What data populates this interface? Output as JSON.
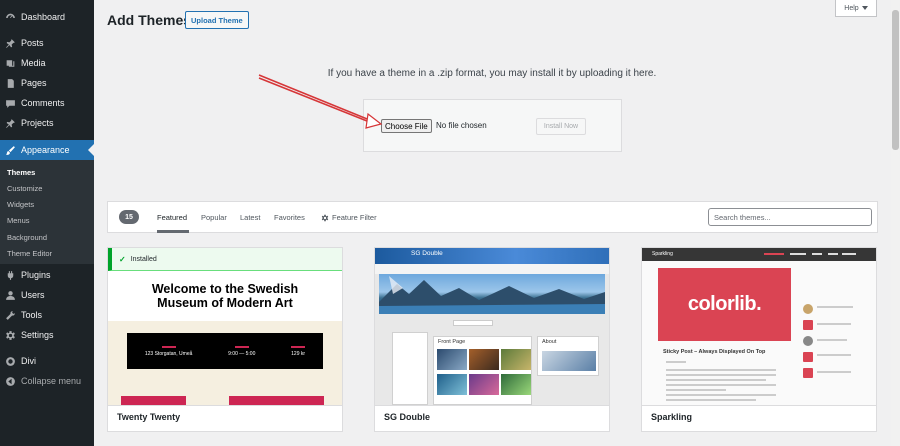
{
  "sidebar": {
    "items": [
      {
        "label": "Dashboard",
        "icon": "dashboard-icon"
      },
      {
        "label": "Posts",
        "icon": "pin-icon"
      },
      {
        "label": "Media",
        "icon": "media-icon"
      },
      {
        "label": "Pages",
        "icon": "pages-icon"
      },
      {
        "label": "Comments",
        "icon": "comment-icon"
      },
      {
        "label": "Projects",
        "icon": "pin-icon"
      },
      {
        "label": "Appearance",
        "icon": "brush-icon"
      },
      {
        "label": "Plugins",
        "icon": "plugin-icon"
      },
      {
        "label": "Users",
        "icon": "users-icon"
      },
      {
        "label": "Tools",
        "icon": "wrench-icon"
      },
      {
        "label": "Settings",
        "icon": "settings-icon"
      },
      {
        "label": "Divi",
        "icon": "divi-icon"
      },
      {
        "label": "Collapse menu",
        "icon": "collapse-icon"
      }
    ],
    "submenu": [
      "Themes",
      "Customize",
      "Widgets",
      "Menus",
      "Background",
      "Theme Editor"
    ]
  },
  "header": {
    "title": "Add Themes",
    "upload_label": "Upload Theme",
    "help_label": "Help"
  },
  "upload": {
    "message": "If you have a theme in a .zip format, you may install it by uploading it here.",
    "choose_file": "Choose File",
    "no_file": "No file chosen",
    "install": "Install Now"
  },
  "filter": {
    "count": "15",
    "tabs": [
      "Featured",
      "Popular",
      "Latest",
      "Favorites"
    ],
    "feature_filter": "Feature Filter",
    "search_placeholder": "Search themes..."
  },
  "themes": [
    {
      "name": "Twenty Twenty",
      "installed_label": "Installed",
      "hero": "Welcome to the Swedish Museum of Modern Art",
      "details": [
        "123 Storgatan, Umeå",
        "9:00 — 5:00",
        "129 kr"
      ]
    },
    {
      "name": "SG Double",
      "logo": "SG Double",
      "front_page": "Front Page",
      "about": "About"
    },
    {
      "name": "Sparkling",
      "brand": "colorlib.",
      "post_title": "Sticky Post – Always Displayed On Top",
      "logo": "Sparkling"
    }
  ],
  "colors": {
    "sidebar": "#1d2327",
    "accent": "#2271b1",
    "arrow": "#d63638"
  }
}
